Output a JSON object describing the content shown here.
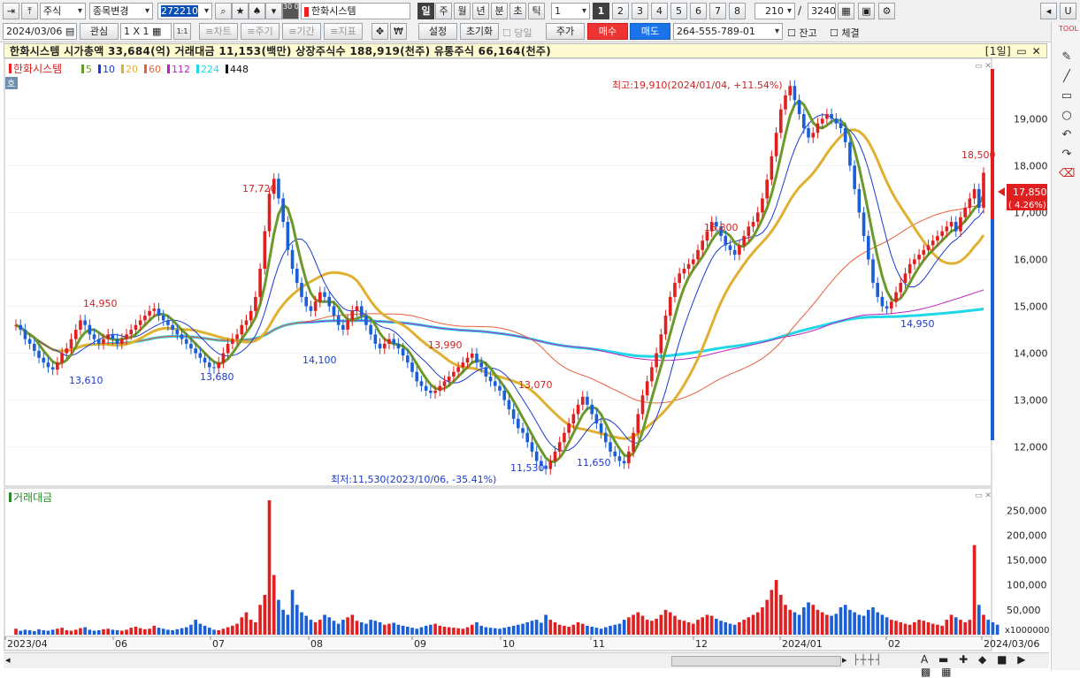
{
  "toolbar1": {
    "type_select": "주식",
    "change_select": "종목변경",
    "code": "272210",
    "stock_name": "한화시스템",
    "period_sel": "일",
    "periods": [
      "주",
      "월",
      "년",
      "분",
      "초",
      "틱"
    ],
    "period_count": "1",
    "presets": [
      "1",
      "2",
      "3",
      "4",
      "5",
      "6",
      "7",
      "8"
    ],
    "count": "210",
    "total": "3240",
    "slash": "/",
    "minute_label": "30 05",
    "u_btn": "U"
  },
  "toolbar2": {
    "date": "2024/03/06",
    "watch_label": "관심",
    "layout": "1 X 1",
    "one_one": "1:1",
    "chart_btn": "≡차트",
    "cycle_btn": "≡주기",
    "range_btn": "≡기간",
    "indicator_btn": "≡지표",
    "won_icon": "₩",
    "setting": "설정",
    "reset": "초기화",
    "today_label": "당일",
    "price_btn": "주가",
    "buy_btn": "매수",
    "sell_btn": "매도",
    "account": "264-555-789-01",
    "balance_label": "잔고",
    "fill_label": "체결"
  },
  "info": {
    "text": "한화시스템  시가총액 33,684(억)  거래대금 11,153(백만)  상장주식수 188,919(천주)  유통주식 66,164(천주)",
    "right": "[1일]"
  },
  "legend": {
    "title": "한화시스템",
    "ma": [
      {
        "label": "5",
        "color": "#6b9a2a"
      },
      {
        "label": "10",
        "color": "#1a3ad0"
      },
      {
        "label": "20",
        "color": "#e0b030"
      },
      {
        "label": "60",
        "color": "#e8603a"
      },
      {
        "label": "112",
        "color": "#c020c0"
      },
      {
        "label": "224",
        "color": "#20d8e8"
      },
      {
        "label": "448",
        "color": "#111111"
      }
    ],
    "hoga": "호",
    "volume_title": "거래대금"
  },
  "tools": {
    "label": "TOOL",
    "close": "✕"
  },
  "chart_data": {
    "type": "candlestick",
    "price_axis": {
      "min": 11500,
      "max": 19900,
      "ticks": [
        12000,
        13000,
        14000,
        15000,
        16000,
        17000,
        18000,
        19000
      ],
      "tick_labels": [
        "12,000",
        "13,000",
        "14,000",
        "15,000",
        "16,000",
        "17,000",
        "18,000",
        "19,000"
      ]
    },
    "volume_axis": {
      "max": 270000,
      "ticks": [
        50000,
        100000,
        150000,
        200000,
        250000
      ],
      "tick_labels": [
        "50,000",
        "100,000",
        "150,000",
        "200,000",
        "250,000"
      ],
      "unit": "x1000000"
    },
    "x_labels": [
      "2023/04",
      "06",
      "07",
      "08",
      "09",
      "10",
      "11",
      "12",
      "2024/01",
      "02",
      "2024/03/06"
    ],
    "last_price": "17,850",
    "last_change": "(  4.26%)",
    "high_annotation": "최고:19,910(2024/01/04, +11.54%)",
    "low_annotation": "최저:11,530(2023/10/06, -35.41%)",
    "price_labels": [
      {
        "text": "14,950",
        "color": "#d02020"
      },
      {
        "text": "13,610",
        "color": "#1a3ad0"
      },
      {
        "text": "17,720",
        "color": "#d02020"
      },
      {
        "text": "13,680",
        "color": "#1a3ad0"
      },
      {
        "text": "14,100",
        "color": "#1a3ad0"
      },
      {
        "text": "13,990",
        "color": "#d02020"
      },
      {
        "text": "13,070",
        "color": "#d02020"
      },
      {
        "text": "11,530",
        "color": "#1a3ad0"
      },
      {
        "text": "11,650",
        "color": "#1a3ad0"
      },
      {
        "text": "16,800",
        "color": "#d02020"
      },
      {
        "text": "14,950",
        "color": "#1a3ad0"
      },
      {
        "text": "18,500",
        "color": "#d02020"
      }
    ],
    "close_series": [
      14600,
      14500,
      14300,
      14200,
      14050,
      13900,
      13800,
      13700,
      13650,
      13800,
      14000,
      14100,
      14300,
      14500,
      14700,
      14600,
      14400,
      14300,
      14200,
      14300,
      14400,
      14300,
      14200,
      14300,
      14400,
      14500,
      14600,
      14700,
      14800,
      14900,
      14950,
      14800,
      14700,
      14600,
      14500,
      14400,
      14300,
      14200,
      14100,
      14000,
      13900,
      13800,
      13700,
      13680,
      13800,
      14000,
      14200,
      14300,
      14400,
      14600,
      14700,
      14900,
      15200,
      15800,
      16600,
      17400,
      17720,
      17300,
      16800,
      16200,
      15800,
      15500,
      15200,
      15000,
      14900,
      15100,
      15300,
      15200,
      15000,
      14800,
      14600,
      14500,
      14700,
      14900,
      15000,
      14800,
      14600,
      14400,
      14200,
      14100,
      14200,
      14300,
      14200,
      14100,
      13950,
      13800,
      13600,
      13400,
      13300,
      13200,
      13150,
      13200,
      13300,
      13400,
      13500,
      13600,
      13700,
      13800,
      13900,
      13990,
      13800,
      13700,
      13500,
      13400,
      13300,
      13200,
      13000,
      12800,
      12600,
      12400,
      12300,
      12100,
      11900,
      11700,
      11600,
      11530,
      11700,
      11900,
      12100,
      12300,
      12500,
      12700,
      12900,
      13070,
      12900,
      12700,
      12500,
      12300,
      12100,
      11900,
      11800,
      11700,
      11650,
      11900,
      12300,
      12700,
      13100,
      13400,
      13700,
      14000,
      14400,
      14800,
      15200,
      15500,
      15700,
      15800,
      15900,
      16000,
      16200,
      16400,
      16600,
      16800,
      16700,
      16500,
      16300,
      16200,
      16100,
      16300,
      16500,
      16700,
      16800,
      17000,
      17300,
      17700,
      18200,
      18700,
      19200,
      19500,
      19700,
      19400,
      19100,
      18800,
      18600,
      18700,
      18900,
      19000,
      19100,
      19000,
      18900,
      18800,
      18500,
      18000,
      17500,
      17000,
      16500,
      16000,
      15500,
      15200,
      15000,
      14950,
      15100,
      15300,
      15500,
      15700,
      15900,
      16000,
      16100,
      16200,
      16300,
      16400,
      16500,
      16600,
      16700,
      16800,
      16600,
      16900,
      17100,
      17300,
      17500,
      17100,
      17850
    ],
    "volume_series": [
      12,
      8,
      10,
      9,
      7,
      11,
      9,
      8,
      10,
      12,
      14,
      9,
      8,
      10,
      13,
      15,
      10,
      8,
      9,
      11,
      12,
      10,
      9,
      8,
      10,
      14,
      16,
      13,
      11,
      12,
      18,
      14,
      12,
      10,
      9,
      11,
      13,
      15,
      20,
      30,
      22,
      18,
      14,
      10,
      9,
      12,
      15,
      18,
      22,
      35,
      45,
      30,
      25,
      60,
      80,
      270,
      120,
      70,
      50,
      40,
      90,
      60,
      45,
      38,
      30,
      25,
      30,
      40,
      35,
      28,
      22,
      30,
      35,
      40,
      28,
      25,
      22,
      30,
      28,
      25,
      20,
      22,
      24,
      20,
      18,
      16,
      14,
      12,
      15,
      18,
      20,
      22,
      18,
      16,
      15,
      14,
      13,
      12,
      15,
      20,
      25,
      18,
      15,
      14,
      13,
      12,
      14,
      16,
      18,
      20,
      22,
      25,
      28,
      30,
      24,
      40,
      30,
      25,
      20,
      18,
      16,
      20,
      25,
      22,
      18,
      16,
      14,
      12,
      15,
      18,
      20,
      22,
      30,
      35,
      40,
      45,
      38,
      30,
      28,
      32,
      40,
      50,
      45,
      38,
      30,
      28,
      25,
      22,
      30,
      35,
      40,
      38,
      32,
      28,
      25,
      22,
      20,
      25,
      30,
      35,
      40,
      45,
      55,
      70,
      90,
      110,
      80,
      60,
      50,
      45,
      40,
      55,
      65,
      60,
      50,
      45,
      40,
      38,
      42,
      55,
      60,
      50,
      45,
      40,
      38,
      50,
      55,
      45,
      40,
      35,
      30,
      28,
      25,
      22,
      20,
      25,
      30,
      28,
      25,
      22,
      20,
      18,
      30,
      40,
      35,
      30,
      25,
      30,
      180,
      60,
      40,
      30,
      25,
      20
    ],
    "volume_colors_up_down": [
      "#e02020",
      "#1a5fd8"
    ]
  }
}
